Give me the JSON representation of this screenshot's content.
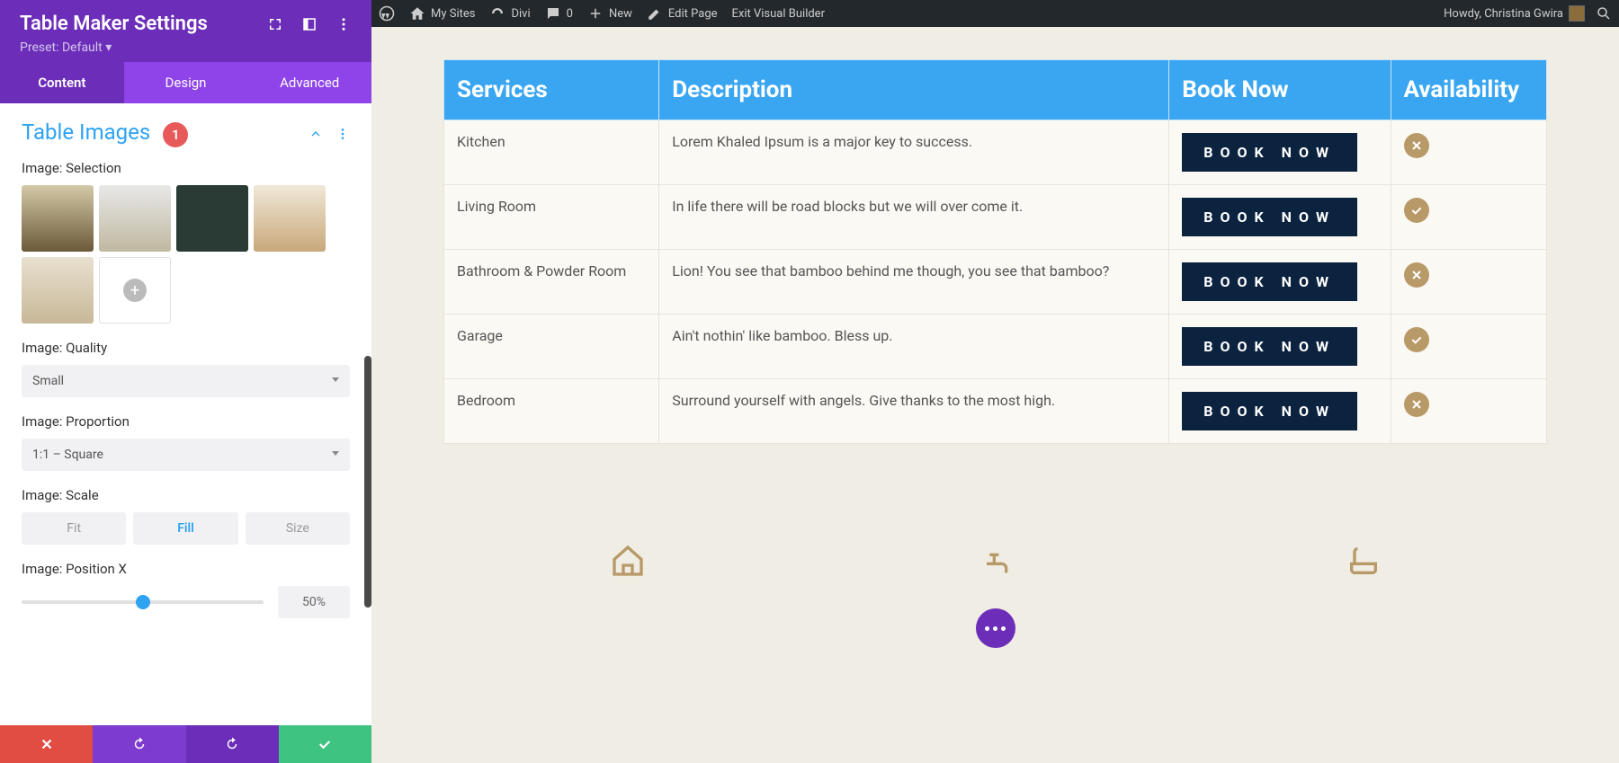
{
  "adminBar": {
    "mySites": "My Sites",
    "divi": "Divi",
    "comments": "0",
    "new": "New",
    "editPage": "Edit Page",
    "exitVB": "Exit Visual Builder",
    "howdy": "Howdy, Christina Gwira"
  },
  "sidebar": {
    "title": "Table Maker Settings",
    "preset": "Preset: Default ▾",
    "tabs": {
      "content": "Content",
      "design": "Design",
      "advanced": "Advanced"
    },
    "section": {
      "title": "Table Images",
      "badge": "1"
    },
    "labels": {
      "selection": "Image: Selection",
      "quality": "Image: Quality",
      "proportion": "Image: Proportion",
      "scale": "Image: Scale",
      "positionX": "Image: Position X"
    },
    "quality": "Small",
    "proportion": "1:1 – Square",
    "scaleOptions": {
      "fit": "Fit",
      "fill": "Fill",
      "size": "Size"
    },
    "positionX": "50%"
  },
  "table": {
    "headers": {
      "services": "Services",
      "description": "Description",
      "book": "Book Now",
      "availability": "Availability"
    },
    "rows": [
      {
        "service": "Kitchen",
        "desc": "Lorem Khaled Ipsum is a major key to success.",
        "avail": "no"
      },
      {
        "service": "Living Room",
        "desc": "In life there will be road blocks but we will over come it.",
        "avail": "yes"
      },
      {
        "service": "Bathroom & Powder Room",
        "desc": "Lion! You see that bamboo behind me though, you see that bamboo?",
        "avail": "no"
      },
      {
        "service": "Garage",
        "desc": "Ain't nothin' like bamboo. Bless up.",
        "avail": "yes"
      },
      {
        "service": "Bedroom",
        "desc": "Surround yourself with angels. Give thanks to the most high.",
        "avail": "no"
      }
    ],
    "bookLabel": "BOOK NOW"
  }
}
